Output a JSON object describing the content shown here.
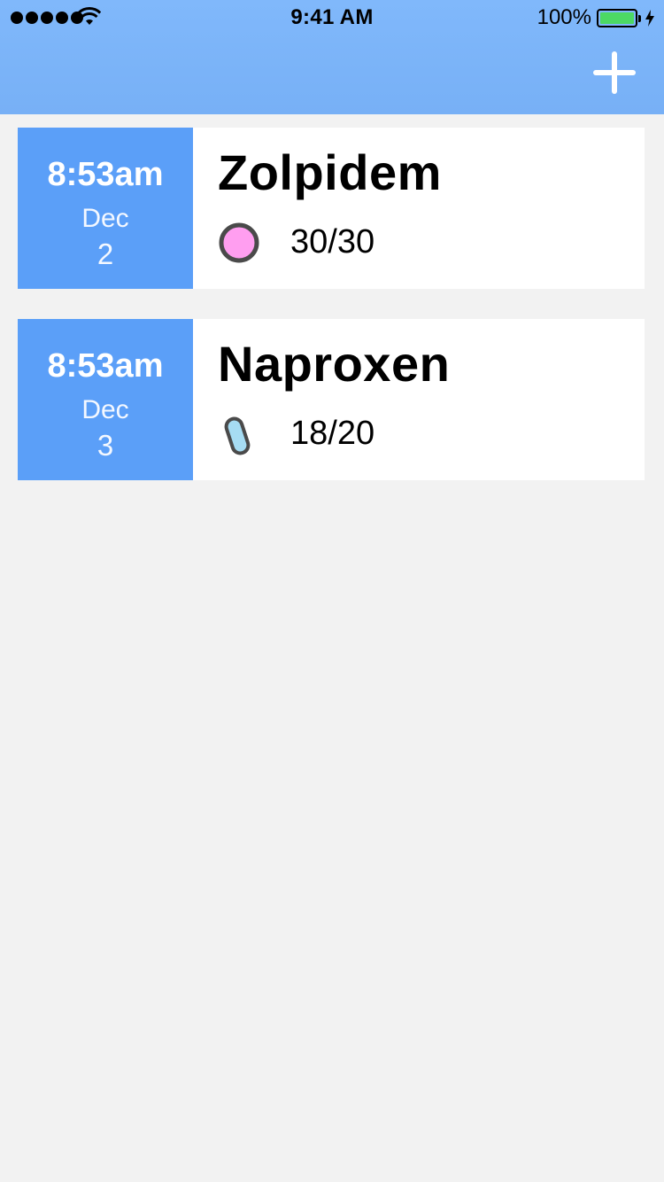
{
  "status_bar": {
    "time": "9:41 AM",
    "battery": "100%",
    "icons": [
      "signal-dots-icon",
      "wifi-icon",
      "battery-icon",
      "charging-bolt-icon"
    ]
  },
  "header": {
    "add_icon": "plus-icon"
  },
  "medications": [
    {
      "time": "8:53am",
      "month": "Dec",
      "day": "2",
      "name": "Zolpidem",
      "count": "30/30",
      "pill_icon": "round-pill-icon",
      "pill_color": "#ff9ef0"
    },
    {
      "time": "8:53am",
      "month": "Dec",
      "day": "3",
      "name": "Naproxen",
      "count": "18/20",
      "pill_icon": "capsule-pill-icon",
      "pill_color": "#a6dcf3"
    }
  ],
  "colors": {
    "header": "#7ab3f8",
    "date_block": "#5b9ff8",
    "background": "#f2f2f2",
    "battery_fill": "#4cd964"
  }
}
